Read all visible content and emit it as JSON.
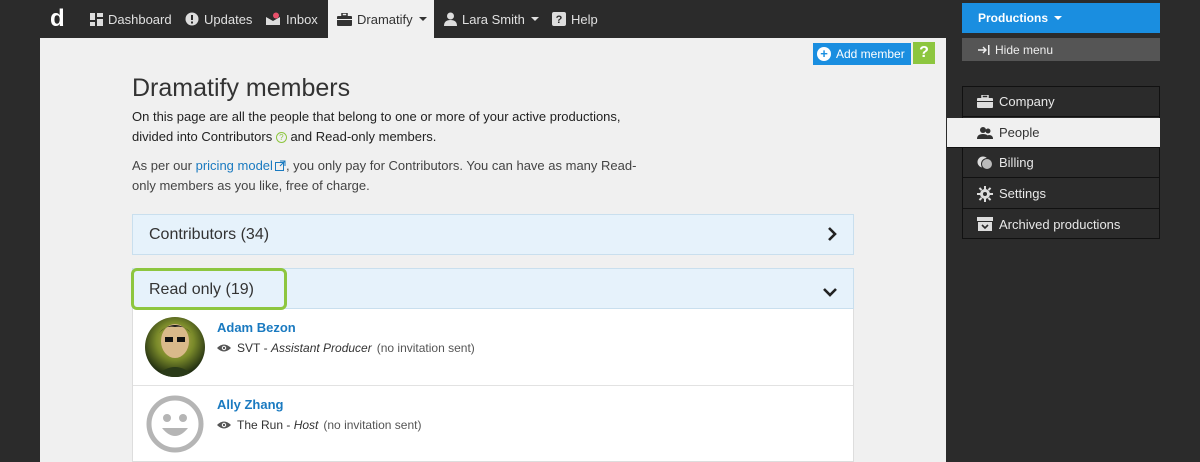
{
  "nav": {
    "logo": "d",
    "items": [
      {
        "label": "Dashboard"
      },
      {
        "label": "Updates"
      },
      {
        "label": "Inbox"
      },
      {
        "label": "Dramatify"
      },
      {
        "label": "Lara Smith"
      },
      {
        "label": "Help"
      }
    ]
  },
  "toolbar": {
    "add_member_label": "Add member",
    "help_label": "?"
  },
  "page": {
    "title": "Dramatify members",
    "intro_1": "On this page are all the people that belong to one or more of your active productions, divided into Contributors",
    "intro_2": "and Read-only members.",
    "pricing_pre": "As per our",
    "pricing_link": "pricing model",
    "pricing_post": ", you only pay for Contributors. You can have as many Read-only members as you like, free of charge."
  },
  "panels": {
    "contributors": "Contributors (34)",
    "readonly": "Read only (19)"
  },
  "members": [
    {
      "name": "Adam Bezon",
      "org": "SVT",
      "sep": " - ",
      "role": "Assistant Producer",
      "status": "(no invitation sent)"
    },
    {
      "name": "Ally Zhang",
      "org": "The Run",
      "sep": " - ",
      "role": "Host",
      "status": "(no invitation sent)"
    }
  ],
  "sidebar": {
    "productions_label": "Productions",
    "hide_menu_label": "Hide menu",
    "items": [
      {
        "label": "Company",
        "icon": "briefcase-icon"
      },
      {
        "label": "People",
        "icon": "people-icon"
      },
      {
        "label": "Billing",
        "icon": "coins-icon"
      },
      {
        "label": "Settings",
        "icon": "gear-icon"
      },
      {
        "label": "Archived productions",
        "icon": "archive-icon"
      }
    ]
  },
  "colors": {
    "accent_blue": "#1a8ee0",
    "highlight_green": "#8dc63f",
    "dark_bg": "#2b2b2b"
  }
}
